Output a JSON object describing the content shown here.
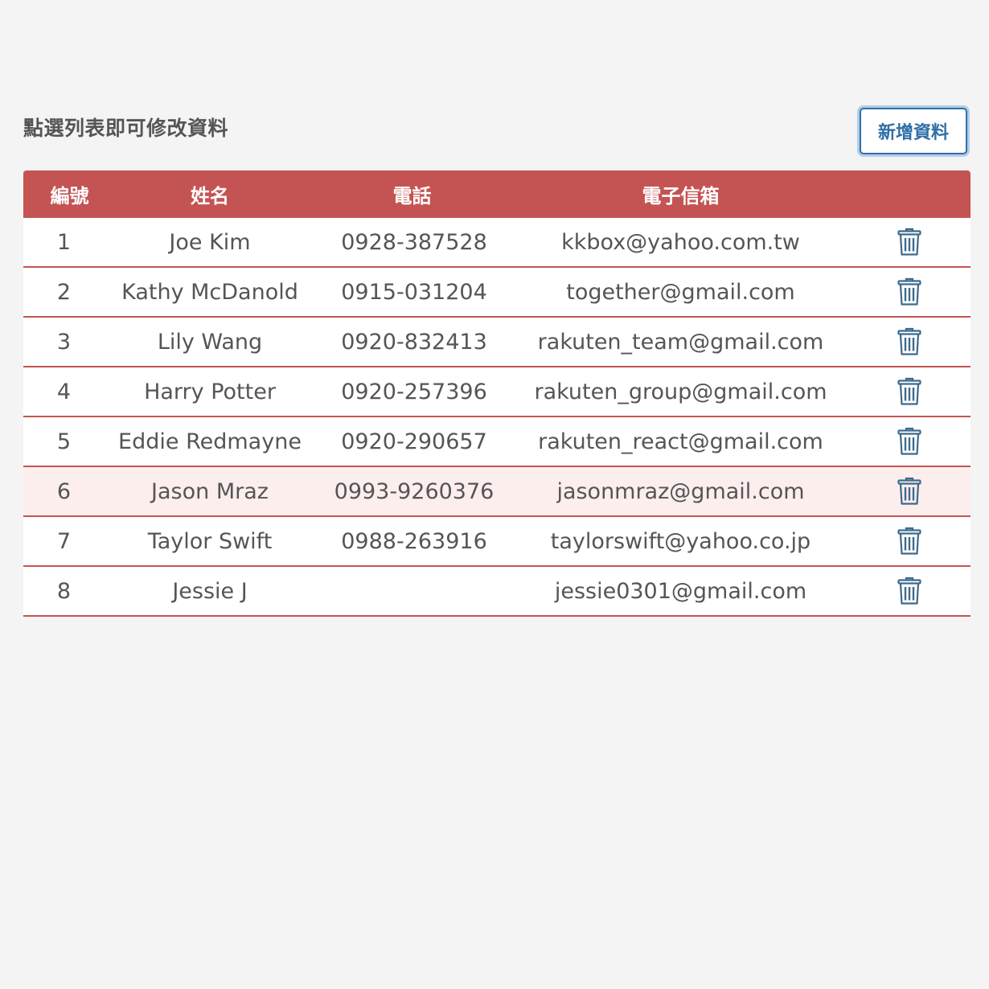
{
  "hint": "點選列表即可修改資料",
  "add_button": "新增資料",
  "colors": {
    "header_bg": "#c45454",
    "row_border": "#c45454",
    "highlight_row": "#fdeeee",
    "button_text": "#2f6fa8",
    "trash_icon": "#3d6a8c"
  },
  "table": {
    "headers": [
      "編號",
      "姓名",
      "電話",
      "電子信箱"
    ],
    "rows": [
      {
        "no": "1",
        "name": "Joe Kim",
        "tel": "0928-387528",
        "email": "kkbox@yahoo.com.tw"
      },
      {
        "no": "2",
        "name": "Kathy McDanold",
        "tel": "0915-031204",
        "email": "together@gmail.com"
      },
      {
        "no": "3",
        "name": "Lily Wang",
        "tel": "0920-832413",
        "email": "rakuten_team@gmail.com"
      },
      {
        "no": "4",
        "name": "Harry Potter",
        "tel": "0920-257396",
        "email": "rakuten_group@gmail.com"
      },
      {
        "no": "5",
        "name": "Eddie Redmayne",
        "tel": "0920-290657",
        "email": "rakuten_react@gmail.com"
      },
      {
        "no": "6",
        "name": "Jason Mraz",
        "tel": "0993-9260376",
        "email": "jasonmraz@gmail.com"
      },
      {
        "no": "7",
        "name": "Taylor Swift",
        "tel": "0988-263916",
        "email": "taylorswift@yahoo.co.jp"
      },
      {
        "no": "8",
        "name": "Jessie J",
        "tel": "",
        "email": "jessie0301@gmail.com"
      }
    ],
    "highlighted_row": 6,
    "row_action_icon": "trash-icon"
  }
}
